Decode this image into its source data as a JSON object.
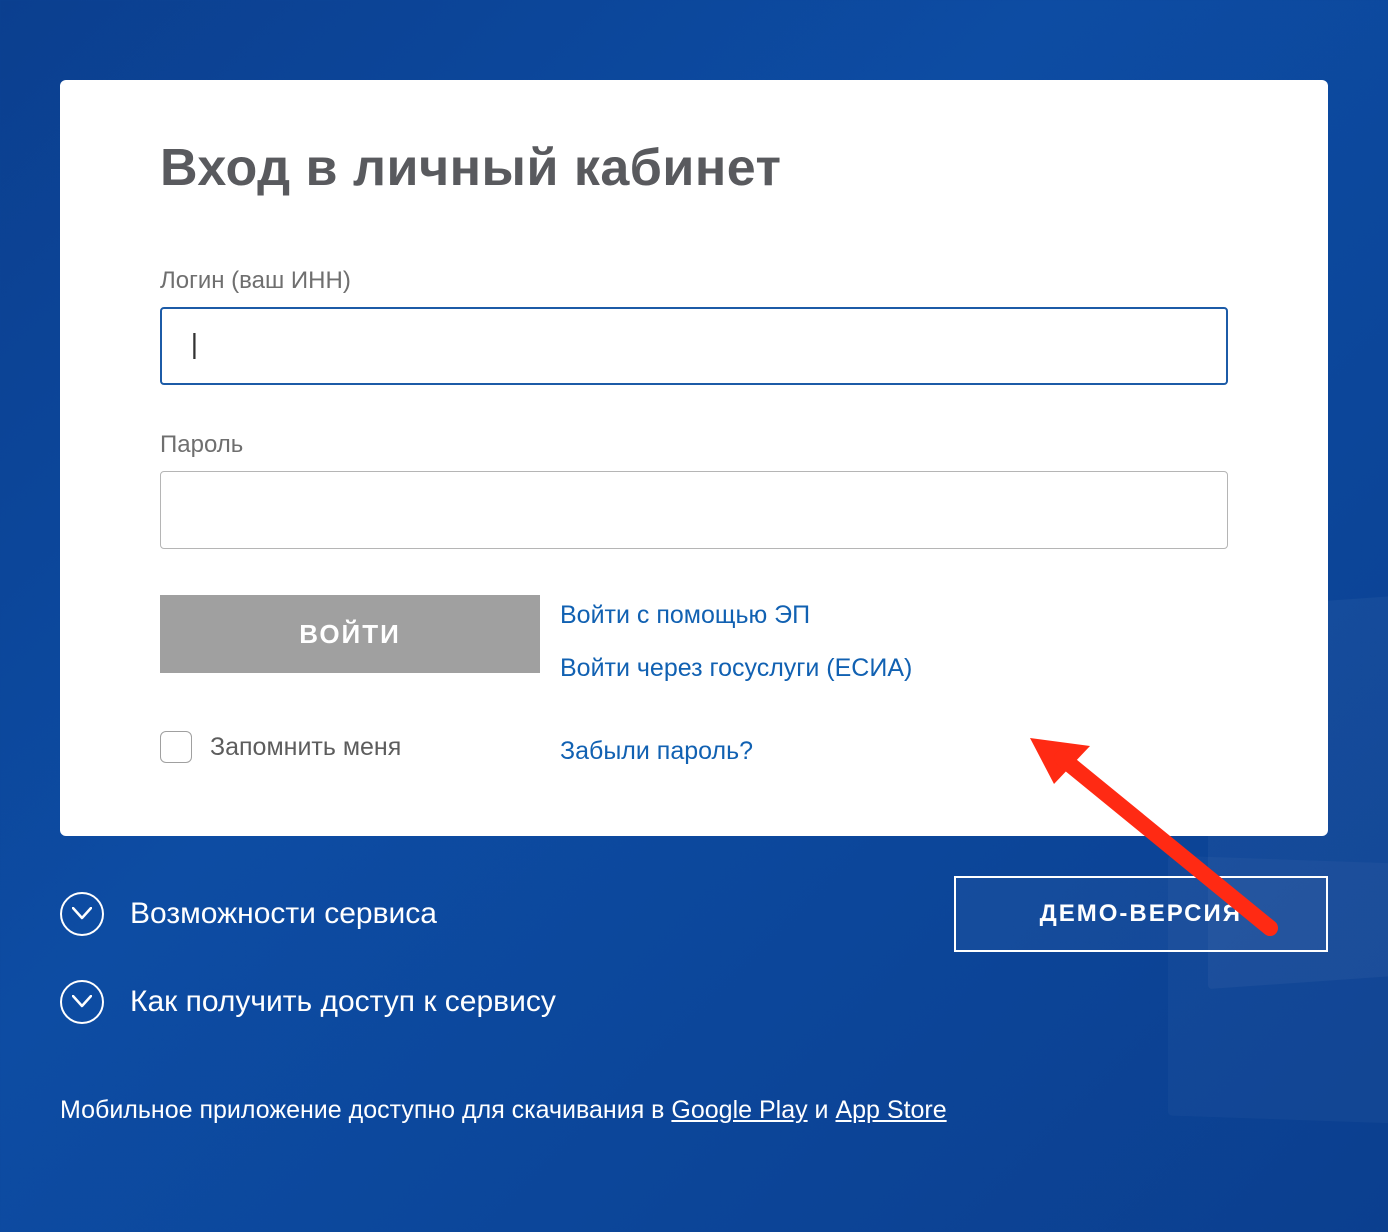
{
  "card": {
    "title": "Вход в личный кабинет",
    "login_label": "Логин (ваш ИНН)",
    "login_value": "|",
    "password_label": "Пароль",
    "password_value": "",
    "submit_label": "ВОЙТИ",
    "remember_label": "Запомнить меня",
    "alt_ep_label": "Войти с помощью ЭП",
    "alt_esia_label": "Войти через госуслуги (ЕСИА)",
    "forgot_label": "Забыли пароль?"
  },
  "footer": {
    "features_label": "Возможности сервиса",
    "howto_label": "Как получить доступ к сервису",
    "demo_label": "ДЕМО-ВЕРСИЯ",
    "apps_prefix": "Мобильное приложение доступно для скачивания в ",
    "google_play": "Google Play",
    "apps_conj": " и ",
    "app_store": "App Store"
  }
}
